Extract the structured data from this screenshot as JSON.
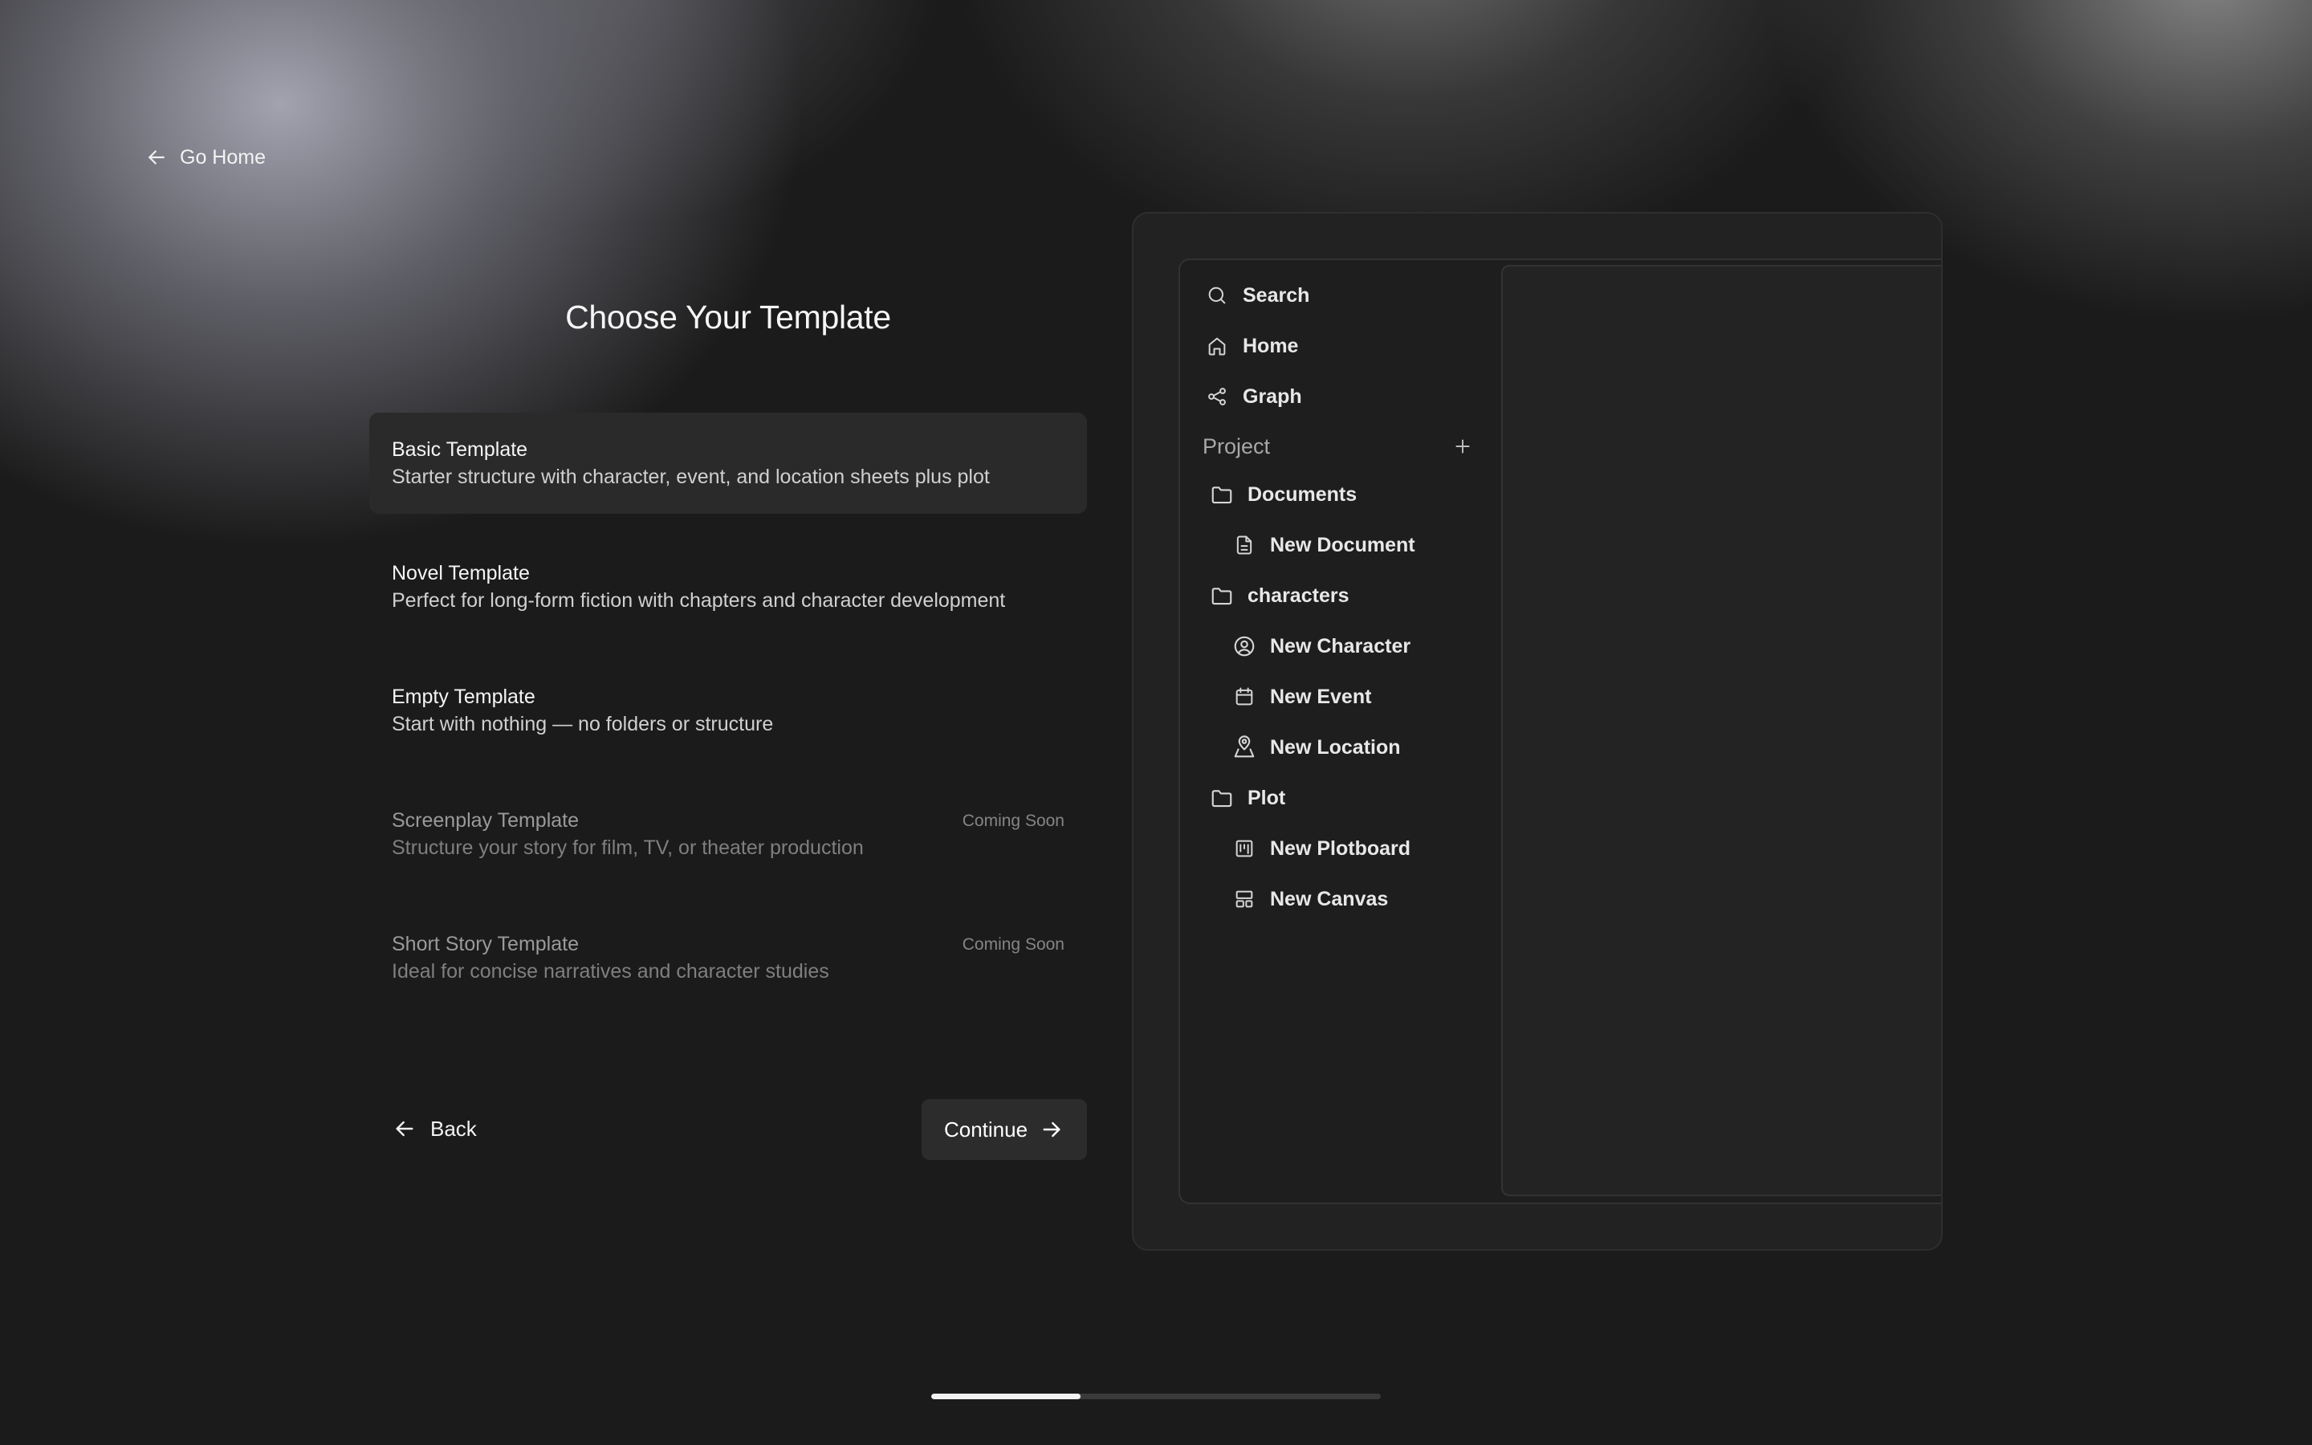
{
  "nav": {
    "go_home_label": "Go Home"
  },
  "page": {
    "title": "Choose Your Template"
  },
  "templates": [
    {
      "name": "Basic Template",
      "description": "Starter structure with character, event, and location sheets plus plot",
      "badge": "",
      "selected": true,
      "disabled": false
    },
    {
      "name": "Novel Template",
      "description": "Perfect for long-form fiction with chapters and character development",
      "badge": "",
      "selected": false,
      "disabled": false
    },
    {
      "name": "Empty Template",
      "description": "Start with nothing — no folders or structure",
      "badge": "",
      "selected": false,
      "disabled": false
    },
    {
      "name": "Screenplay Template",
      "description": "Structure your story for film, TV, or theater production",
      "badge": "Coming Soon",
      "selected": false,
      "disabled": true
    },
    {
      "name": "Short Story Template",
      "description": "Ideal for concise narratives and character studies",
      "badge": "Coming Soon",
      "selected": false,
      "disabled": true
    }
  ],
  "actions": {
    "back_label": "Back",
    "continue_label": "Continue"
  },
  "preview": {
    "nav": [
      {
        "label": "Search",
        "icon": "search-icon"
      },
      {
        "label": "Home",
        "icon": "home-icon"
      },
      {
        "label": "Graph",
        "icon": "graph-icon"
      }
    ],
    "section_label": "Project",
    "tree": [
      {
        "label": "Documents",
        "icon": "folder-icon",
        "level": 0
      },
      {
        "label": "New Document",
        "icon": "document-icon",
        "level": 1
      },
      {
        "label": "characters",
        "icon": "folder-icon",
        "level": 0
      },
      {
        "label": "New Character",
        "icon": "user-circle-icon",
        "level": 1
      },
      {
        "label": "New Event",
        "icon": "calendar-icon",
        "level": 1
      },
      {
        "label": "New Location",
        "icon": "map-pin-icon",
        "level": 1
      },
      {
        "label": "Plot",
        "icon": "folder-icon",
        "level": 0
      },
      {
        "label": "New Plotboard",
        "icon": "kanban-icon",
        "level": 1
      },
      {
        "label": "New Canvas",
        "icon": "layout-icon",
        "level": 1
      }
    ]
  },
  "progress": {
    "value": 0.333
  },
  "colors": {
    "background": "#1b1b1b",
    "selected_card": "#2a2a2a",
    "accent": "#f2f2f2"
  }
}
